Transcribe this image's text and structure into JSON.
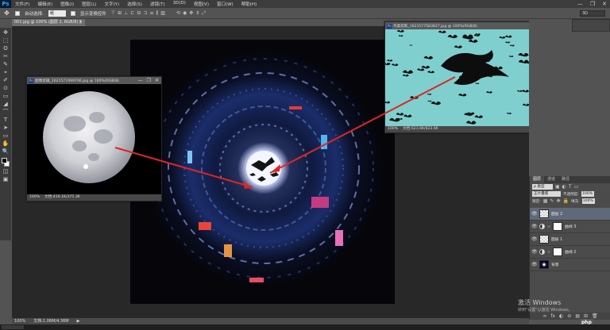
{
  "app": {
    "logo": "Ps"
  },
  "menu": [
    "文件(F)",
    "编辑(E)",
    "图像(I)",
    "图层(L)",
    "文字(Y)",
    "选择(S)",
    "滤镜(T)",
    "3D(D)",
    "视图(V)",
    "窗口(W)",
    "帮助(H)"
  ],
  "window_controls": {
    "minimize": "—",
    "restore": "❐",
    "close": "✕"
  },
  "options": {
    "auto_select_label": "自动选择:",
    "auto_select_value": "组",
    "show_transform_label": "显示变换控件",
    "workspace_value": "3D"
  },
  "doc_tab": {
    "label": "001.jpg @ 100% (图层 2, RGB/8) *",
    "close": "×"
  },
  "tools": [
    "✥",
    "⬚",
    "ʘ",
    "✂",
    "✎",
    "⌖",
    "✐",
    "⊙",
    "▭",
    "◢",
    "⌒",
    "T",
    "➤",
    "▭",
    "✋",
    "🔍"
  ],
  "document": {
    "status_zoom": "100%",
    "status_doc": "文档:1.06M/4.36M",
    "status_arrow": "▶"
  },
  "moon_window": {
    "title": "图像剪辑_1621577499706.jpg @ 100%(RGB/8)",
    "zoom": "100%",
    "doc": "文档:416.1K/375.3K",
    "controls": {
      "minimize": "—",
      "maximize": "❐",
      "close": "✕"
    }
  },
  "birds_window": {
    "title": "鸟类剪影_1621577583827.jpg @ 100%(RGB/8)",
    "zoom": "100%",
    "doc": "文档:623.6K/623.6K",
    "controls": {
      "minimize": "—",
      "maximize": "❐",
      "close": "✕"
    }
  },
  "layers_panel": {
    "tabs": [
      "图层",
      "通道",
      "路径"
    ],
    "kind_filter": "ρ 类型",
    "blend_mode": "正片叠底",
    "opacity_label": "不透明度:",
    "opacity_value": "100%",
    "lock_label": "锁定:",
    "fill_label": "填充:",
    "fill_value": "100%",
    "layers": [
      {
        "name": "图层 2",
        "selected": true,
        "thumb": "checker",
        "mask": false,
        "adjust": false
      },
      {
        "name": "曲线 3",
        "selected": false,
        "thumb": "",
        "mask": true,
        "adjust": true
      },
      {
        "name": "图层 1",
        "selected": false,
        "thumb": "checker",
        "mask": false,
        "adjust": false
      },
      {
        "name": "曲线 2",
        "selected": false,
        "thumb": "",
        "mask": true,
        "adjust": true
      },
      {
        "name": "背景",
        "selected": false,
        "thumb": "bg",
        "mask": false,
        "adjust": false
      }
    ],
    "footer_icons": [
      "∞",
      "fx",
      "◐",
      "⊘",
      "▤",
      "⊞",
      "🗑"
    ]
  },
  "watermark": {
    "line1": "激活 Windows",
    "line2": "转到\"设置\"以激活 Windows。",
    "badge": "php"
  },
  "colors": {
    "annotation_arrow": "#e02424",
    "sky_blue": "#7fcfcf",
    "selected_layer": "#5e6a7a"
  }
}
